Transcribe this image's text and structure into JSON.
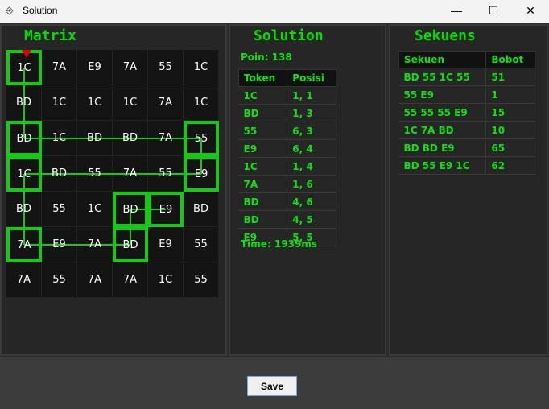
{
  "window": {
    "title": "Solution",
    "minimize": "—",
    "maximize": "☐",
    "close": "✕",
    "icon": "door-exit-icon"
  },
  "matrix": {
    "title": "Matrix",
    "rows": [
      [
        "1C",
        "7A",
        "E9",
        "7A",
        "55",
        "1C"
      ],
      [
        "BD",
        "1C",
        "1C",
        "1C",
        "7A",
        "1C"
      ],
      [
        "BD",
        "1C",
        "BD",
        "BD",
        "7A",
        "55"
      ],
      [
        "1C",
        "BD",
        "55",
        "7A",
        "55",
        "E9"
      ],
      [
        "BD",
        "55",
        "1C",
        "BD",
        "E9",
        "BD"
      ],
      [
        "7A",
        "E9",
        "7A",
        "BD",
        "E9",
        "55"
      ],
      [
        "7A",
        "55",
        "7A",
        "7A",
        "1C",
        "55"
      ]
    ],
    "path": [
      [
        1,
        1
      ],
      [
        1,
        3
      ],
      [
        6,
        3
      ],
      [
        6,
        4
      ],
      [
        1,
        4
      ],
      [
        1,
        6
      ],
      [
        4,
        6
      ],
      [
        4,
        5
      ],
      [
        5,
        5
      ]
    ],
    "line_color": "#18c818",
    "marker_color": "#e00000"
  },
  "solution": {
    "title": "Solution",
    "points": "Poin: 138",
    "headers": [
      "Token",
      "Posisi"
    ],
    "rows": [
      [
        "1C",
        "1, 1"
      ],
      [
        "BD",
        "1, 3"
      ],
      [
        "55",
        "6, 3"
      ],
      [
        "E9",
        "6, 4"
      ],
      [
        "1C",
        "1, 4"
      ],
      [
        "7A",
        "1, 6"
      ],
      [
        "BD",
        "4, 6"
      ],
      [
        "BD",
        "4, 5"
      ],
      [
        "E9",
        "5, 5"
      ]
    ],
    "time": "Time: 1939ms"
  },
  "sekuens": {
    "title": "Sekuens",
    "headers": [
      "Sekuen",
      "Bobot"
    ],
    "rows": [
      [
        "BD 55 1C 55",
        "51"
      ],
      [
        "55 E9",
        "1"
      ],
      [
        "55 55 55 E9",
        "15"
      ],
      [
        "1C 7A BD",
        "10"
      ],
      [
        "BD BD E9",
        "65"
      ],
      [
        "BD 55 E9 1C",
        "62"
      ]
    ]
  },
  "footer": {
    "save_label": "Save"
  },
  "colors": {
    "accent": "#10e010",
    "background": "#2b2b2b"
  }
}
